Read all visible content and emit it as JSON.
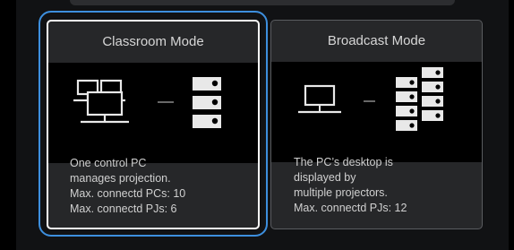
{
  "modes": [
    {
      "title": "Classroom Mode",
      "desc": [
        "One control PC",
        "manages projection.",
        "Max. connectd PCs: 10",
        "Max. connectd PJs: 6"
      ]
    },
    {
      "title": "Broadcast Mode",
      "desc": [
        "The PC’s desktop is",
        "displayed by",
        "multiple projectors.",
        "Max. connectd PJs: 12"
      ]
    }
  ],
  "colors": {
    "focus": "#3d8fde",
    "card": "#262729",
    "icon": "#e8e8e8"
  }
}
